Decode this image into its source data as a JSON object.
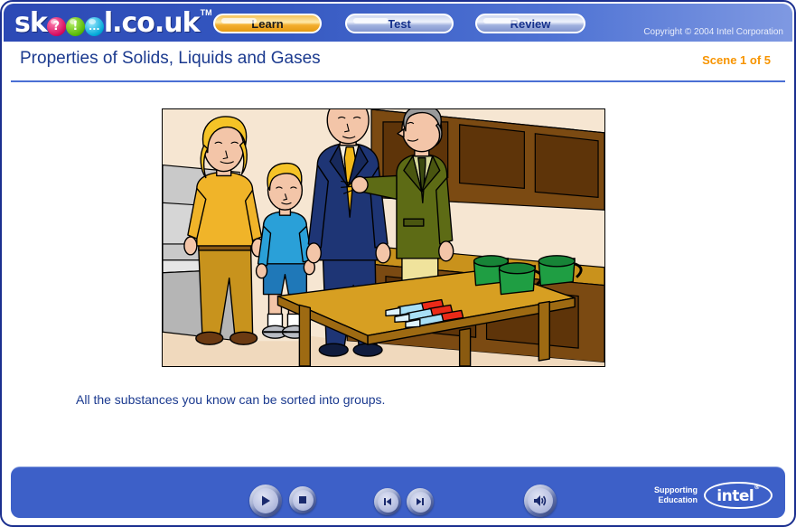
{
  "header": {
    "logo": {
      "part1": "sk",
      "ball1": "?",
      "ball2": "!",
      "ball3": "...",
      "part2": "l.co.uk",
      "trademark": "TM"
    },
    "tabs": [
      {
        "label": "Learn",
        "state": "active"
      },
      {
        "label": "Test",
        "state": "inactive"
      },
      {
        "label": "Review",
        "state": "inactive"
      }
    ],
    "copyright": "Copyright © 2004 Intel Corporation"
  },
  "title": {
    "text": "Properties of Solids, Liquids and Gases",
    "scene_counter": "Scene 1 of 5"
  },
  "illustration": {
    "alt": "Cartoon of a family and a man in a green jacket standing in a room beside a wooden table with three green mugs and three red-handled knives",
    "scene_objects": [
      "woman",
      "boy",
      "man-in-blue-suit",
      "man-in-green-jacket",
      "table",
      "mug",
      "mug",
      "mug",
      "knife",
      "knife",
      "knife"
    ]
  },
  "caption": {
    "text": "All the substances you know can be sorted into groups."
  },
  "footer": {
    "controls": [
      {
        "name": "play",
        "label": "Play"
      },
      {
        "name": "stop",
        "label": "Stop"
      },
      {
        "name": "prev",
        "label": "Previous"
      },
      {
        "name": "next",
        "label": "Next"
      },
      {
        "name": "volume",
        "label": "Volume"
      }
    ],
    "intel": {
      "line1": "Supporting",
      "line2": "Education",
      "wordmark": "intel",
      "registered": "®"
    }
  },
  "colors": {
    "header_blue_dark": "#2c49b5",
    "header_blue_light": "#7f99e2",
    "frame_border": "#1b2f8f",
    "title_blue": "#1b3a8f",
    "scene_orange": "#f79400",
    "footer_blue": "#3d60c8",
    "tab_active_gold": "#f3ae2e",
    "illustration_wall": "#f6e6d2",
    "illustration_table": "#d39b1f",
    "mug_green": "#1f9e43",
    "knife_red": "#e8241c"
  }
}
